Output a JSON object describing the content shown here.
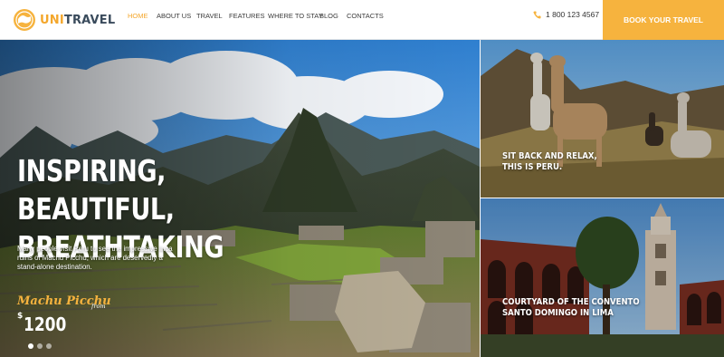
{
  "brand": {
    "uni": "UNI",
    "travel": "TRAVEL",
    "accent": "#f6b33e"
  },
  "nav": {
    "items": [
      {
        "label": "HOME",
        "active": true
      },
      {
        "label": "ABOUT US"
      },
      {
        "label": "TRAVEL"
      },
      {
        "label": "FEATURES"
      },
      {
        "label": "WHERE TO STAY"
      },
      {
        "label": "BLOG"
      },
      {
        "label": "CONTACTS"
      }
    ]
  },
  "contact": {
    "phone": "1 800 123 4567",
    "icon": "phone-icon"
  },
  "cta": {
    "label": "BOOK YOUR TRAVEL"
  },
  "hero": {
    "title_line1": "INSPIRING, BEAUTIFUL,",
    "title_line2": "BREATHTAKING",
    "description": "Many people visit Peru to see the impressive Inca ruins of Machu Picchu, which are deservedly a stand-alone destination.",
    "place": "Machu Picchu",
    "from_label": "from",
    "currency": "$",
    "price": "1200",
    "slides_count": 3,
    "active_slide": 1
  },
  "tiles": [
    {
      "line1": "SIT BACK AND RELAX,",
      "line2": "THIS IS PERU."
    },
    {
      "line1": "COURTYARD OF THE CONVENTO",
      "line2": "SANTO DOMINGO IN LIMA"
    }
  ]
}
